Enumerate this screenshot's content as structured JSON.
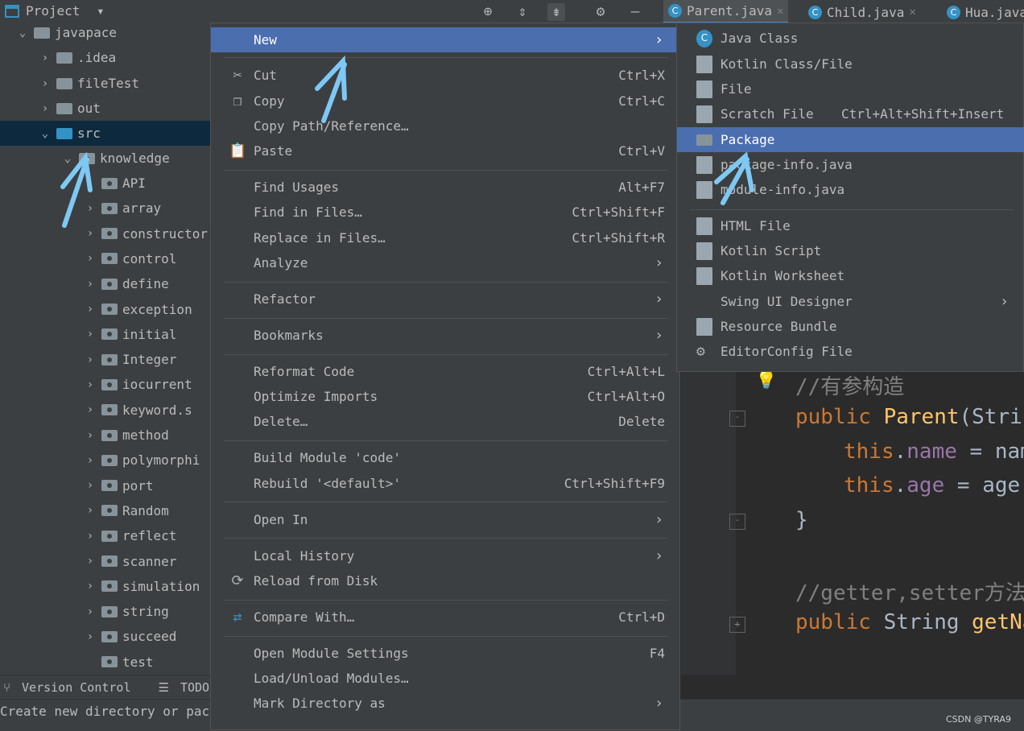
{
  "topbar": {
    "project_label": "Project",
    "tabs": [
      {
        "label": "Parent.java",
        "badge": "C"
      },
      {
        "label": "Child.java",
        "badge": "C"
      },
      {
        "label": "Hua.java",
        "badge": "C"
      }
    ]
  },
  "tree": {
    "root": "javapace",
    "items": [
      ".idea",
      "fileTest",
      "out",
      "src"
    ],
    "knowledge": "knowledge",
    "packages": [
      "API",
      "array",
      "constructor",
      "control",
      "define",
      "exception",
      "initial",
      "Integer",
      "iocurrent",
      "keyword.s",
      "method",
      "polymorphi",
      "port",
      "Random",
      "reflect",
      "scanner",
      "simulation",
      "string",
      "succeed",
      "test"
    ]
  },
  "bottom_tools": {
    "version_control": "Version Control",
    "todo": "TODO"
  },
  "status_text": "Create new directory or pac",
  "watermark": "CSDN @TYRA9",
  "menu": {
    "new": "New",
    "cut": "Cut",
    "cut_sc": "Ctrl+X",
    "copy": "Copy",
    "copy_sc": "Ctrl+C",
    "copy_path": "Copy Path/Reference…",
    "paste": "Paste",
    "paste_sc": "Ctrl+V",
    "find_usages": "Find Usages",
    "find_usages_sc": "Alt+F7",
    "find_files": "Find in Files…",
    "find_files_sc": "Ctrl+Shift+F",
    "replace_files": "Replace in Files…",
    "replace_files_sc": "Ctrl+Shift+R",
    "analyze": "Analyze",
    "refactor": "Refactor",
    "bookmarks": "Bookmarks",
    "reformat": "Reformat Code",
    "reformat_sc": "Ctrl+Alt+L",
    "optimize": "Optimize Imports",
    "optimize_sc": "Ctrl+Alt+O",
    "delete": "Delete…",
    "delete_sc": "Delete",
    "build_module": "Build Module 'code'",
    "rebuild": "Rebuild '<default>'",
    "rebuild_sc": "Ctrl+Shift+F9",
    "open_in": "Open In",
    "local_history": "Local History",
    "reload": "Reload from Disk",
    "compare": "Compare With…",
    "compare_sc": "Ctrl+D",
    "module_settings": "Open Module Settings",
    "module_settings_sc": "F4",
    "load_unload": "Load/Unload Modules…",
    "mark_dir": "Mark Directory as"
  },
  "submenu": {
    "java_class": "Java Class",
    "kotlin_class": "Kotlin Class/File",
    "file": "File",
    "scratch": "Scratch File",
    "scratch_sc": "Ctrl+Alt+Shift+Insert",
    "package": "Package",
    "package_info": "package-info.java",
    "module_info": "module-info.java",
    "html_file": "HTML File",
    "kotlin_script": "Kotlin Script",
    "kotlin_worksheet": "Kotlin Worksheet",
    "swing": "Swing UI Designer",
    "resource_bundle": "Resource Bundle",
    "editorconfig": "EditorConfig File"
  },
  "code": {
    "comment1": "//有参构造",
    "l2_kw": "public",
    "l2_name": "Parent",
    "l2_rest": "(Strin",
    "l3_this": "this",
    "l3_field": "name",
    "l3_rest": " = nam",
    "l4_this": "this",
    "l4_field": "age",
    "l4_rest": " = age",
    "l4_semi": ";",
    "brace": "}",
    "comment2": "//getter,setter方法",
    "l7_kw": "public",
    "l7_type": "String",
    "l7_fn": "getNa"
  }
}
